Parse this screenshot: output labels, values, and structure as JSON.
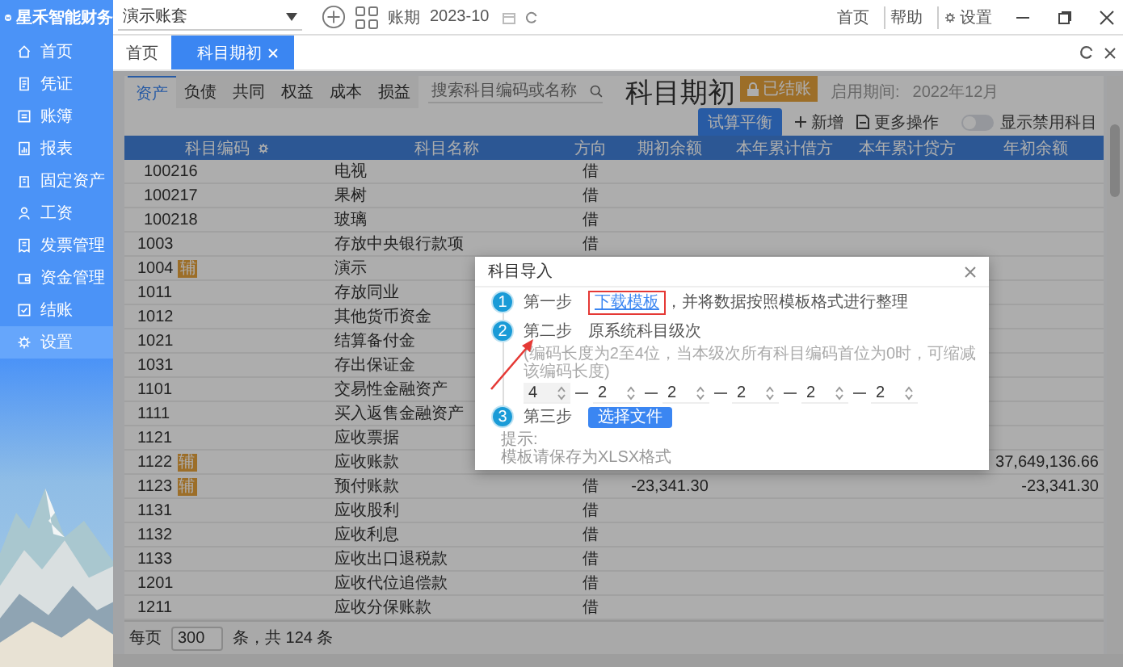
{
  "sidebar": {
    "logo": "星禾智能财务",
    "items": [
      {
        "label": "首页",
        "selected": false
      },
      {
        "label": "凭证",
        "selected": false
      },
      {
        "label": "账簿",
        "selected": false
      },
      {
        "label": "报表",
        "selected": false
      },
      {
        "label": "固定资产",
        "selected": false
      },
      {
        "label": "工资",
        "selected": false
      },
      {
        "label": "发票管理",
        "selected": false
      },
      {
        "label": "资金管理",
        "selected": false
      },
      {
        "label": "结账",
        "selected": false
      },
      {
        "label": "设置",
        "selected": true
      }
    ]
  },
  "topbar": {
    "account_set": "演示账套",
    "period_label": "账期",
    "period": "2023-10",
    "links": [
      "首页",
      "帮助",
      "设置"
    ]
  },
  "page_tabs": [
    {
      "label": "首页",
      "selected": false,
      "closable": false
    },
    {
      "label": "科目期初",
      "selected": true,
      "closable": true
    }
  ],
  "toolbar": {
    "type_tabs": [
      {
        "label": "资产",
        "selected": true
      },
      {
        "label": "负债",
        "selected": false
      },
      {
        "label": "共同",
        "selected": false
      },
      {
        "label": "权益",
        "selected": false
      },
      {
        "label": "成本",
        "selected": false
      },
      {
        "label": "损益",
        "selected": false
      }
    ],
    "search": {
      "placeholder": "搜索科目编码或名称"
    },
    "title": "科目期初",
    "status_badge": "已结账",
    "period_label": "启用期间:",
    "period": "2022年12月",
    "balance_button": "试算平衡",
    "add_button": "新增",
    "more_button": "更多操作",
    "toggle": {
      "label": "显示禁用科目",
      "on": false
    }
  },
  "table": {
    "columns": [
      "科目编码",
      "科目名称",
      "方向",
      "期初余额",
      "本年累计借方",
      "本年累计贷方",
      "年初余额"
    ],
    "rows": [
      {
        "kind": "child",
        "code": "100216",
        "name": "电视",
        "direction": "借"
      },
      {
        "kind": "child",
        "code": "100217",
        "name": "果树",
        "direction": "借"
      },
      {
        "kind": "child",
        "code": "100218",
        "name": "玻璃",
        "direction": "借"
      },
      {
        "kind": "account",
        "code": "1003",
        "name": "存放中央银行款项",
        "direction": "借"
      },
      {
        "kind": "account",
        "code": "1004",
        "tag": "辅",
        "name": "演示"
      },
      {
        "kind": "account",
        "code": "1011",
        "name": "存放同业"
      },
      {
        "kind": "account",
        "code": "1012",
        "name": "其他货币资金"
      },
      {
        "kind": "account",
        "code": "1021",
        "name": "结算备付金"
      },
      {
        "kind": "account",
        "code": "1031",
        "name": "存出保证金"
      },
      {
        "kind": "account",
        "code": "1101",
        "name": "交易性金融资产"
      },
      {
        "kind": "account",
        "code": "1111",
        "name": "买入返售金融资产"
      },
      {
        "kind": "account",
        "code": "1121",
        "name": "应收票据"
      },
      {
        "kind": "account",
        "code": "1122",
        "tag": "辅",
        "name": "应收账款",
        "year_start": "37,649,136.66"
      },
      {
        "kind": "account",
        "code": "1123",
        "tag": "辅",
        "name": "预付账款",
        "direction": "借",
        "opening": "-23,341.30",
        "year_start": "-23,341.30"
      },
      {
        "kind": "account",
        "code": "1131",
        "name": "应收股利",
        "direction": "借"
      },
      {
        "kind": "account",
        "code": "1132",
        "name": "应收利息",
        "direction": "借"
      },
      {
        "kind": "account",
        "code": "1133",
        "name": "应收出口退税款",
        "direction": "借"
      },
      {
        "kind": "account",
        "code": "1201",
        "name": "应收代位追偿款",
        "direction": "借"
      },
      {
        "kind": "account",
        "code": "1211",
        "name": "应收分保账款",
        "direction": "借"
      }
    ]
  },
  "footer": {
    "per_page_label": "每页",
    "per_page": "300",
    "total": "条，共 124 条"
  },
  "dialog": {
    "title": "科目导入",
    "steps": [
      {
        "kind": "download",
        "number": "1",
        "label": "第一步",
        "link": "下载模板",
        "text": "，并将数据按照模板格式进行整理"
      },
      {
        "kind": "levels",
        "number": "2",
        "label": "第二步",
        "text": "原系统科目级次",
        "hint": "(编码长度为2至4位，当本级次所有科目编码首位为0时，可缩减该编码长度)",
        "levels": [
          "4",
          "2",
          "2",
          "2",
          "2",
          "2"
        ]
      },
      {
        "kind": "upload",
        "number": "3",
        "label": "第三步",
        "button": "选择文件"
      }
    ],
    "tip_title": "提示:",
    "tip": "模板请保存为XLSX格式"
  }
}
